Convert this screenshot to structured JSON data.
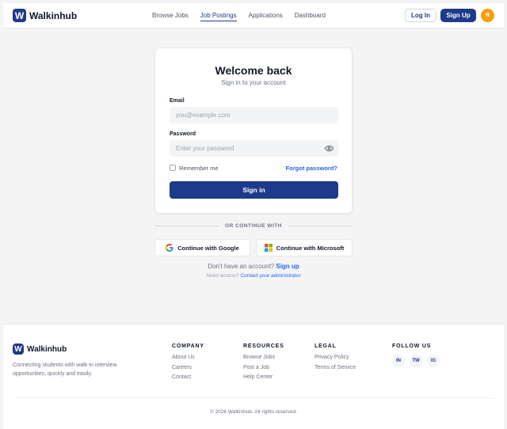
{
  "header": {
    "logo_letter": "W",
    "brand": "Walkinhub",
    "nav": [
      {
        "label": "Browse Jobs",
        "active": false
      },
      {
        "label": "Job Postings",
        "active": true
      },
      {
        "label": "Applications",
        "active": false
      },
      {
        "label": "Dashboard",
        "active": false
      }
    ],
    "login_label": "Log In",
    "signup_label": "Sign Up",
    "avatar_initial": "R"
  },
  "login": {
    "title": "Welcome back",
    "subtitle": "Sign in to your account",
    "email_label": "Email",
    "email_placeholder": "you@example.com",
    "password_label": "Password",
    "password_placeholder": "Enter your password",
    "remember_label": "Remember me",
    "remember_checked": false,
    "forgot_label": "Forgot password?",
    "submit_label": "Sign in"
  },
  "social": {
    "divider_text": "OR CONTINUE WITH",
    "google_label": "Continue with Google",
    "microsoft_label": "Continue with Microsoft"
  },
  "signup_prompt": {
    "text": "Don't have an account?",
    "link": "Sign up"
  },
  "access": {
    "text": "Need access?",
    "link": "Contact your administrator"
  },
  "footer": {
    "brand": "Walkinhub",
    "logo_letter": "W",
    "description": "Connecting students with walk-in interview opportunities, quickly and easily.",
    "company": {
      "heading": "COMPANY",
      "links": [
        "About Us",
        "Careers",
        "Contact"
      ]
    },
    "resources": {
      "heading": "RESOURCES",
      "links": [
        "Browse Jobs",
        "Post a Job",
        "Help Center"
      ]
    },
    "legal": {
      "heading": "LEGAL",
      "links": [
        "Privacy Policy",
        "Terms of Service"
      ]
    },
    "follow": {
      "heading": "FOLLOW US",
      "socials": [
        "IN",
        "TW",
        "IG"
      ]
    },
    "copyright": "© 2026 Walkinhub. All rights reserved."
  },
  "colors": {
    "primary": "#1e3a8a",
    "link": "#2563eb",
    "avatar": "#f59e0b"
  }
}
